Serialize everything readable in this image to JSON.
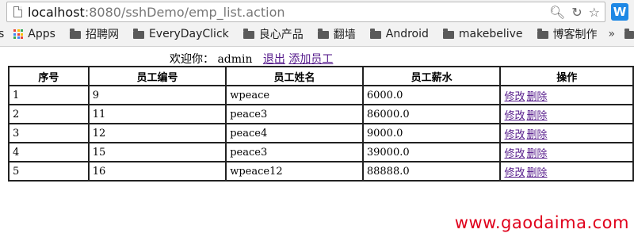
{
  "browser": {
    "url_host": "localhost",
    "url_rest": ":8080/sshDemo/emp_list.action",
    "ext_icon_letter": "W",
    "omnibox_icons": [
      "search-icon",
      "refresh-icon",
      "star-icon"
    ],
    "bookmarks": {
      "apps": "Apps",
      "items": [
        "招聘网",
        "EveryDayClick",
        "良心产品",
        "翻墙",
        "Android",
        "makebelive",
        "博客制作"
      ],
      "overflow": "»"
    },
    "apps_colors": [
      "#ea4335",
      "#fbbc05",
      "#34a853",
      "#4285f4",
      "#ea4335",
      "#fbbc05",
      "#34a853",
      "#4285f4",
      "#ea4335"
    ]
  },
  "welcome": {
    "text": "欢迎你：",
    "user": "admin",
    "logout": "退出",
    "add_employee": "添加员工"
  },
  "table": {
    "headers": [
      "序号",
      "员工编号",
      "员工姓名",
      "员工薪水",
      "操作"
    ],
    "rows": [
      {
        "seq": "1",
        "id": "9",
        "name": "wpeace",
        "salary": "6000.0"
      },
      {
        "seq": "2",
        "id": "11",
        "name": "peace3",
        "salary": "86000.0"
      },
      {
        "seq": "3",
        "id": "12",
        "name": "peace4",
        "salary": "9000.0"
      },
      {
        "seq": "4",
        "id": "15",
        "name": "peace3",
        "salary": "39000.0"
      },
      {
        "seq": "5",
        "id": "16",
        "name": "wpeace12",
        "salary": "88888.0"
      }
    ],
    "edit_label": "修改",
    "delete_label": "删除"
  },
  "watermark": "www.gaodaima.com"
}
